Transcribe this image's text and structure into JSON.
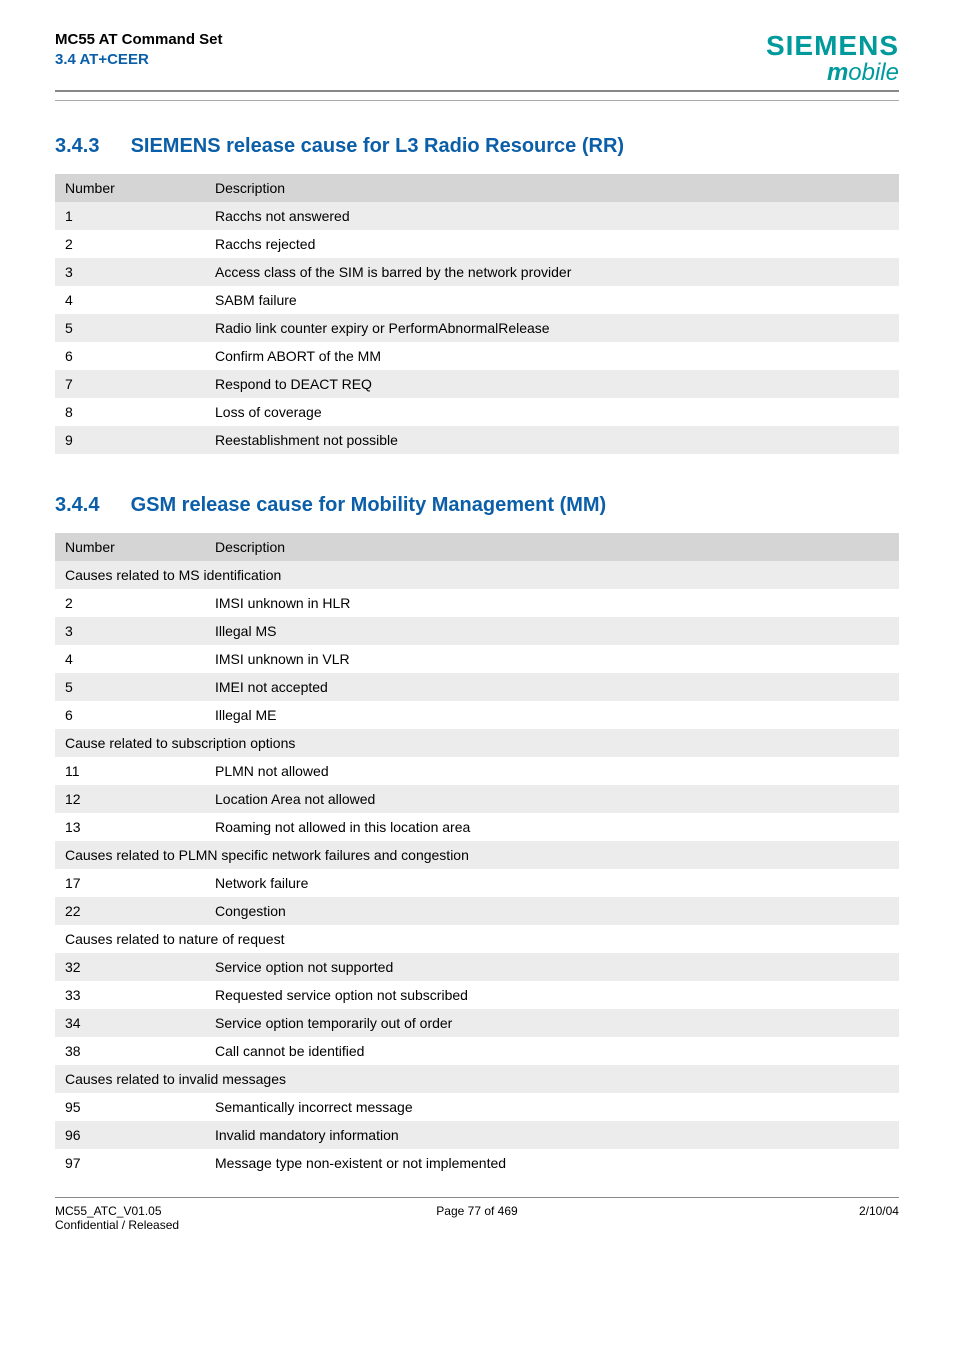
{
  "header": {
    "title_line1": "MC55 AT Command Set",
    "title_line2": "3.4 AT+CEER",
    "logo_main": "SIEMENS",
    "logo_sub_m": "m",
    "logo_sub_rest": "obile"
  },
  "section343": {
    "number": "3.4.3",
    "title": "SIEMENS release cause for L3 Radio Resource (RR)",
    "col_number": "Number",
    "col_description": "Description",
    "rows": [
      {
        "num": "1",
        "desc": "Racchs not answered"
      },
      {
        "num": "2",
        "desc": "Racchs rejected"
      },
      {
        "num": "3",
        "desc": "Access class of the SIM is barred by the network provider"
      },
      {
        "num": "4",
        "desc": "SABM failure"
      },
      {
        "num": "5",
        "desc": "Radio link counter expiry or PerformAbnormalRelease"
      },
      {
        "num": "6",
        "desc": "Confirm ABORT of the MM"
      },
      {
        "num": "7",
        "desc": "Respond to DEACT REQ"
      },
      {
        "num": "8",
        "desc": "Loss of coverage"
      },
      {
        "num": "9",
        "desc": "Reestablishment not possible"
      }
    ]
  },
  "section344": {
    "number": "3.4.4",
    "title": "GSM release cause for Mobility Management (MM)",
    "col_number": "Number",
    "col_description": "Description",
    "groups": [
      {
        "label": "Causes related to MS identification",
        "rows": [
          {
            "num": "2",
            "desc": "IMSI unknown in HLR"
          },
          {
            "num": "3",
            "desc": "Illegal MS"
          },
          {
            "num": "4",
            "desc": "IMSI unknown in VLR"
          },
          {
            "num": "5",
            "desc": "IMEI not accepted"
          },
          {
            "num": "6",
            "desc": "Illegal ME"
          }
        ]
      },
      {
        "label": "Cause related to subscription options",
        "rows": [
          {
            "num": "11",
            "desc": "PLMN not allowed"
          },
          {
            "num": "12",
            "desc": "Location Area not allowed"
          },
          {
            "num": "13",
            "desc": "Roaming not allowed in this location area"
          }
        ]
      },
      {
        "label": "Causes related to PLMN specific network failures and congestion",
        "rows": [
          {
            "num": "17",
            "desc": "Network failure"
          },
          {
            "num": "22",
            "desc": "Congestion"
          }
        ]
      },
      {
        "label": "Causes related to nature of request",
        "rows": [
          {
            "num": "32",
            "desc": "Service option not supported"
          },
          {
            "num": "33",
            "desc": "Requested service option not subscribed"
          },
          {
            "num": "34",
            "desc": "Service option temporarily out of order"
          },
          {
            "num": "38",
            "desc": "Call cannot be identified"
          }
        ]
      },
      {
        "label": "Causes related to invalid messages",
        "rows": [
          {
            "num": "95",
            "desc": "Semantically incorrect message"
          },
          {
            "num": "96",
            "desc": "Invalid mandatory information"
          },
          {
            "num": "97",
            "desc": "Message type non-existent or not implemented"
          }
        ]
      }
    ]
  },
  "footer": {
    "left_line1": "MC55_ATC_V01.05",
    "left_line2": "Confidential / Released",
    "center": "Page 77 of 469",
    "right": "2/10/04"
  }
}
